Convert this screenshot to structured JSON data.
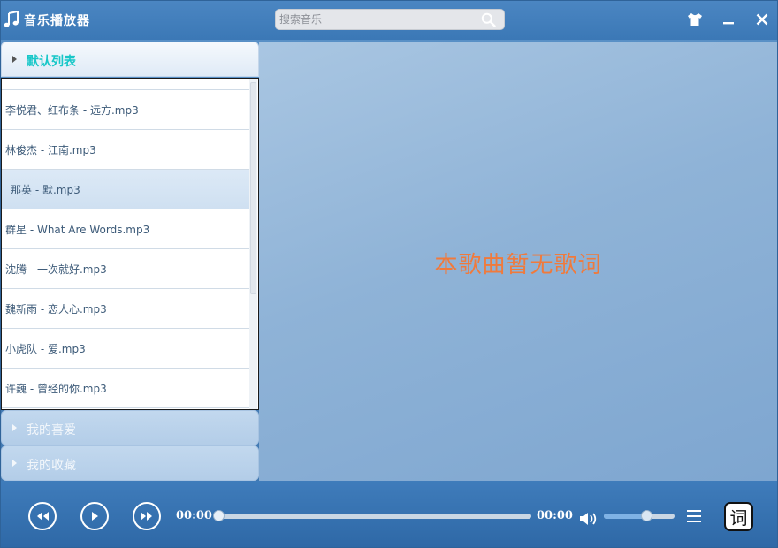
{
  "app": {
    "title": "音乐播放器"
  },
  "search": {
    "placeholder": "搜索音乐",
    "value": ""
  },
  "window_controls": {
    "skin_icon": "tshirt-icon",
    "minimize_icon": "minimize-icon",
    "close_icon": "close-icon"
  },
  "sidebar": {
    "groups": [
      {
        "label": "默认列表",
        "expanded": true
      },
      {
        "label": "我的喜爱",
        "expanded": false
      },
      {
        "label": "我的收藏",
        "expanded": false
      }
    ],
    "songs": [
      {
        "title": ""
      },
      {
        "title": "李悦君、红布条 - 远方.mp3"
      },
      {
        "title": "林俊杰 - 江南.mp3"
      },
      {
        "title": "那英 - 默.mp3",
        "active": true
      },
      {
        "title": "群星 - What Are Words.mp3"
      },
      {
        "title": "沈腾 - 一次就好.mp3"
      },
      {
        "title": "魏新雨 - 恋人心.mp3"
      },
      {
        "title": "小虎队 - 爱.mp3"
      },
      {
        "title": "许巍 - 曾经的你.mp3"
      }
    ]
  },
  "lyrics": {
    "message": "本歌曲暂无歌词"
  },
  "player": {
    "current_time": "00:00",
    "total_time": "00:00",
    "progress": 0.0,
    "volume": 0.6,
    "lyric_button": "词"
  },
  "colors": {
    "accent": "#18c7c8",
    "lyrics": "#f07a3c",
    "titlebar": "#3b78b6",
    "controlbar": "#2e68a6"
  }
}
